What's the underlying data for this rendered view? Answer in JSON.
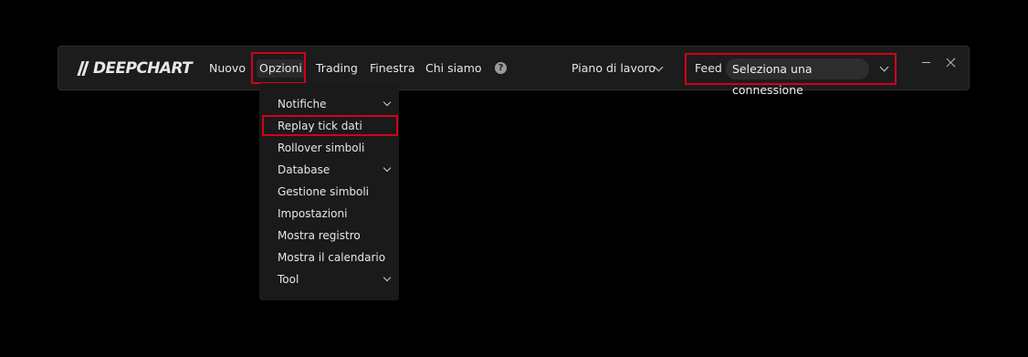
{
  "app": {
    "logo_text": "DEEPCHART"
  },
  "menu": {
    "items": [
      "Nuovo",
      "Opzioni",
      "Trading",
      "Finestra",
      "Chi siamo"
    ],
    "help_icon": "help-circle-icon"
  },
  "workspace": {
    "label": "Piano di lavoro"
  },
  "feed": {
    "label": "Feed",
    "connection_value": "Seleziona una connessione"
  },
  "window_controls": {
    "minimize_icon": "minimize-icon",
    "close_icon": "close-icon"
  },
  "dropdown": {
    "items": [
      {
        "label": "Notifiche",
        "has_submenu": true
      },
      {
        "label": "Replay tick dati",
        "has_submenu": false
      },
      {
        "label": "Rollover simboli",
        "has_submenu": false
      },
      {
        "label": "Database",
        "has_submenu": true
      },
      {
        "label": "Gestione simboli",
        "has_submenu": false
      },
      {
        "label": "Impostazioni",
        "has_submenu": false
      },
      {
        "label": "Mostra registro",
        "has_submenu": false
      },
      {
        "label": "Mostra il calendario",
        "has_submenu": false
      },
      {
        "label": "Tool",
        "has_submenu": true
      }
    ]
  },
  "colors": {
    "highlight": "#d0021b",
    "toolbar_bg": "#1c1c1c",
    "menu_bg": "#1a1a1a"
  }
}
